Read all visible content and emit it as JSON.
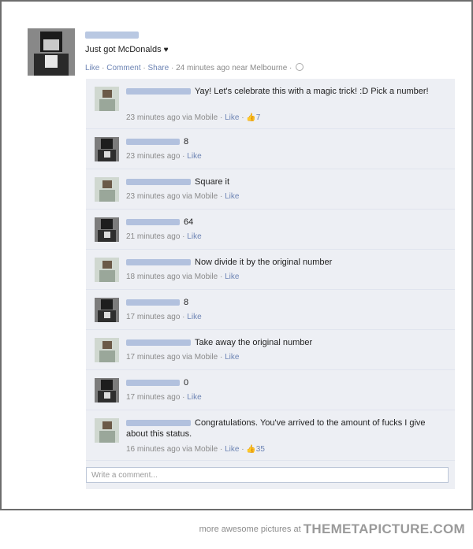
{
  "post": {
    "text": "Just got McDonalds",
    "heart": "♥",
    "actions": [
      "Like",
      "Comment",
      "Share"
    ],
    "time": "24 minutes ago near Melbourne"
  },
  "comments": [
    {
      "text": "Yay! Let's celebrate this with a magic trick! :D Pick a number!",
      "time": "23 minutes ago via Mobile",
      "like": "Like",
      "likes": "7"
    },
    {
      "text": "8",
      "time": "23 minutes ago",
      "like": "Like"
    },
    {
      "text": "Square it",
      "time": "23 minutes ago via Mobile",
      "like": "Like"
    },
    {
      "text": "64",
      "time": "21 minutes ago",
      "like": "Like"
    },
    {
      "text": "Now divide it by the original number",
      "time": "18 minutes ago via Mobile",
      "like": "Like"
    },
    {
      "text": "8",
      "time": "17 minutes ago",
      "like": "Like"
    },
    {
      "text": "Take away the original number",
      "time": "17 minutes ago via Mobile",
      "like": "Like"
    },
    {
      "text": "0",
      "time": "17 minutes ago",
      "like": "Like"
    },
    {
      "text": "Congratulations. You've arrived to the amount of fucks I give about this status.",
      "time": "16 minutes ago via Mobile",
      "like": "Like",
      "likes": "35"
    }
  ],
  "write_comment": {
    "placeholder": "Write a comment..."
  },
  "footer": {
    "prefix": "more awesome pictures at",
    "site": "THEMETAPICTURE.COM"
  }
}
